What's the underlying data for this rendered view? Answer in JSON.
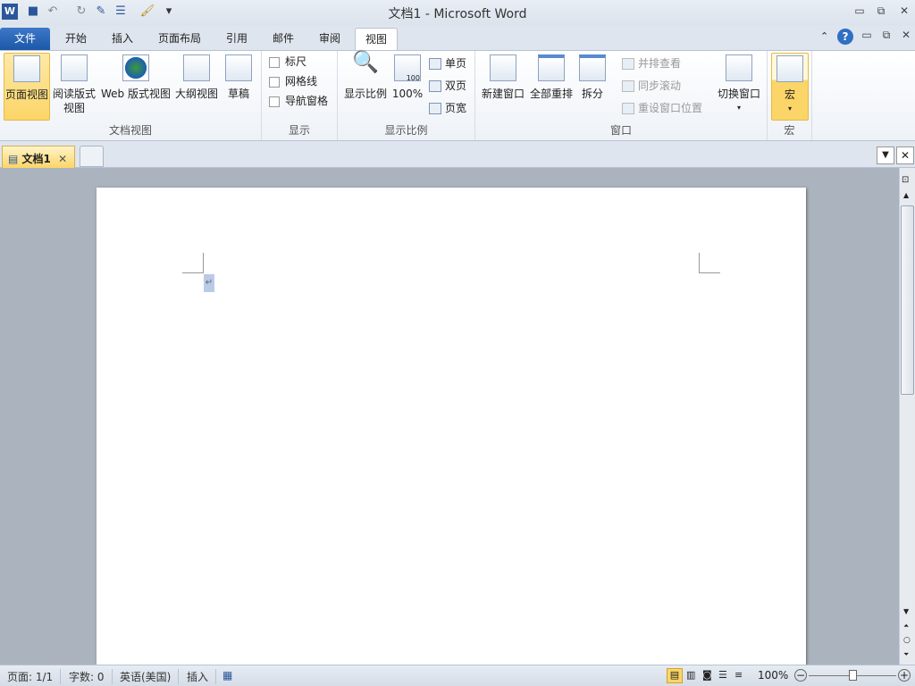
{
  "window": {
    "title": "文档1  -  Microsoft Word"
  },
  "quick_access": {
    "app_icon": "W"
  },
  "tabs": [
    {
      "label": "文件"
    },
    {
      "label": "开始"
    },
    {
      "label": "插入"
    },
    {
      "label": "页面布局"
    },
    {
      "label": "引用"
    },
    {
      "label": "邮件"
    },
    {
      "label": "审阅"
    },
    {
      "label": "视图"
    }
  ],
  "ribbon": {
    "doc_views": {
      "label": "文档视图",
      "items": [
        "页面视图",
        "阅读版式\n视图",
        "Web 版式视图",
        "大纲视图",
        "草稿"
      ]
    },
    "show": {
      "label": "显示",
      "items": [
        "标尺",
        "网格线",
        "导航窗格"
      ]
    },
    "zoom": {
      "label": "显示比例",
      "zoom": "显示比例",
      "pct": "100%",
      "single": "单页",
      "double": "双页",
      "width": "页宽",
      "icon_text": "100"
    },
    "window": {
      "label": "窗口",
      "new": "新建窗口",
      "arrange": "全部重排",
      "split": "拆分",
      "side": "并排查看",
      "sync": "同步滚动",
      "reset": "重设窗口位置",
      "switch": "切换窗口"
    },
    "macros": {
      "label": "宏",
      "item": "宏"
    }
  },
  "doc_tab": {
    "label": "文档1"
  },
  "status": {
    "page": "页面: 1/1",
    "words": "字数: 0",
    "lang": "英语(美国)",
    "mode": "插入",
    "zoom": "100%"
  },
  "colors": {
    "file_tab": "#2b5fad",
    "selected": "#fbd567"
  }
}
